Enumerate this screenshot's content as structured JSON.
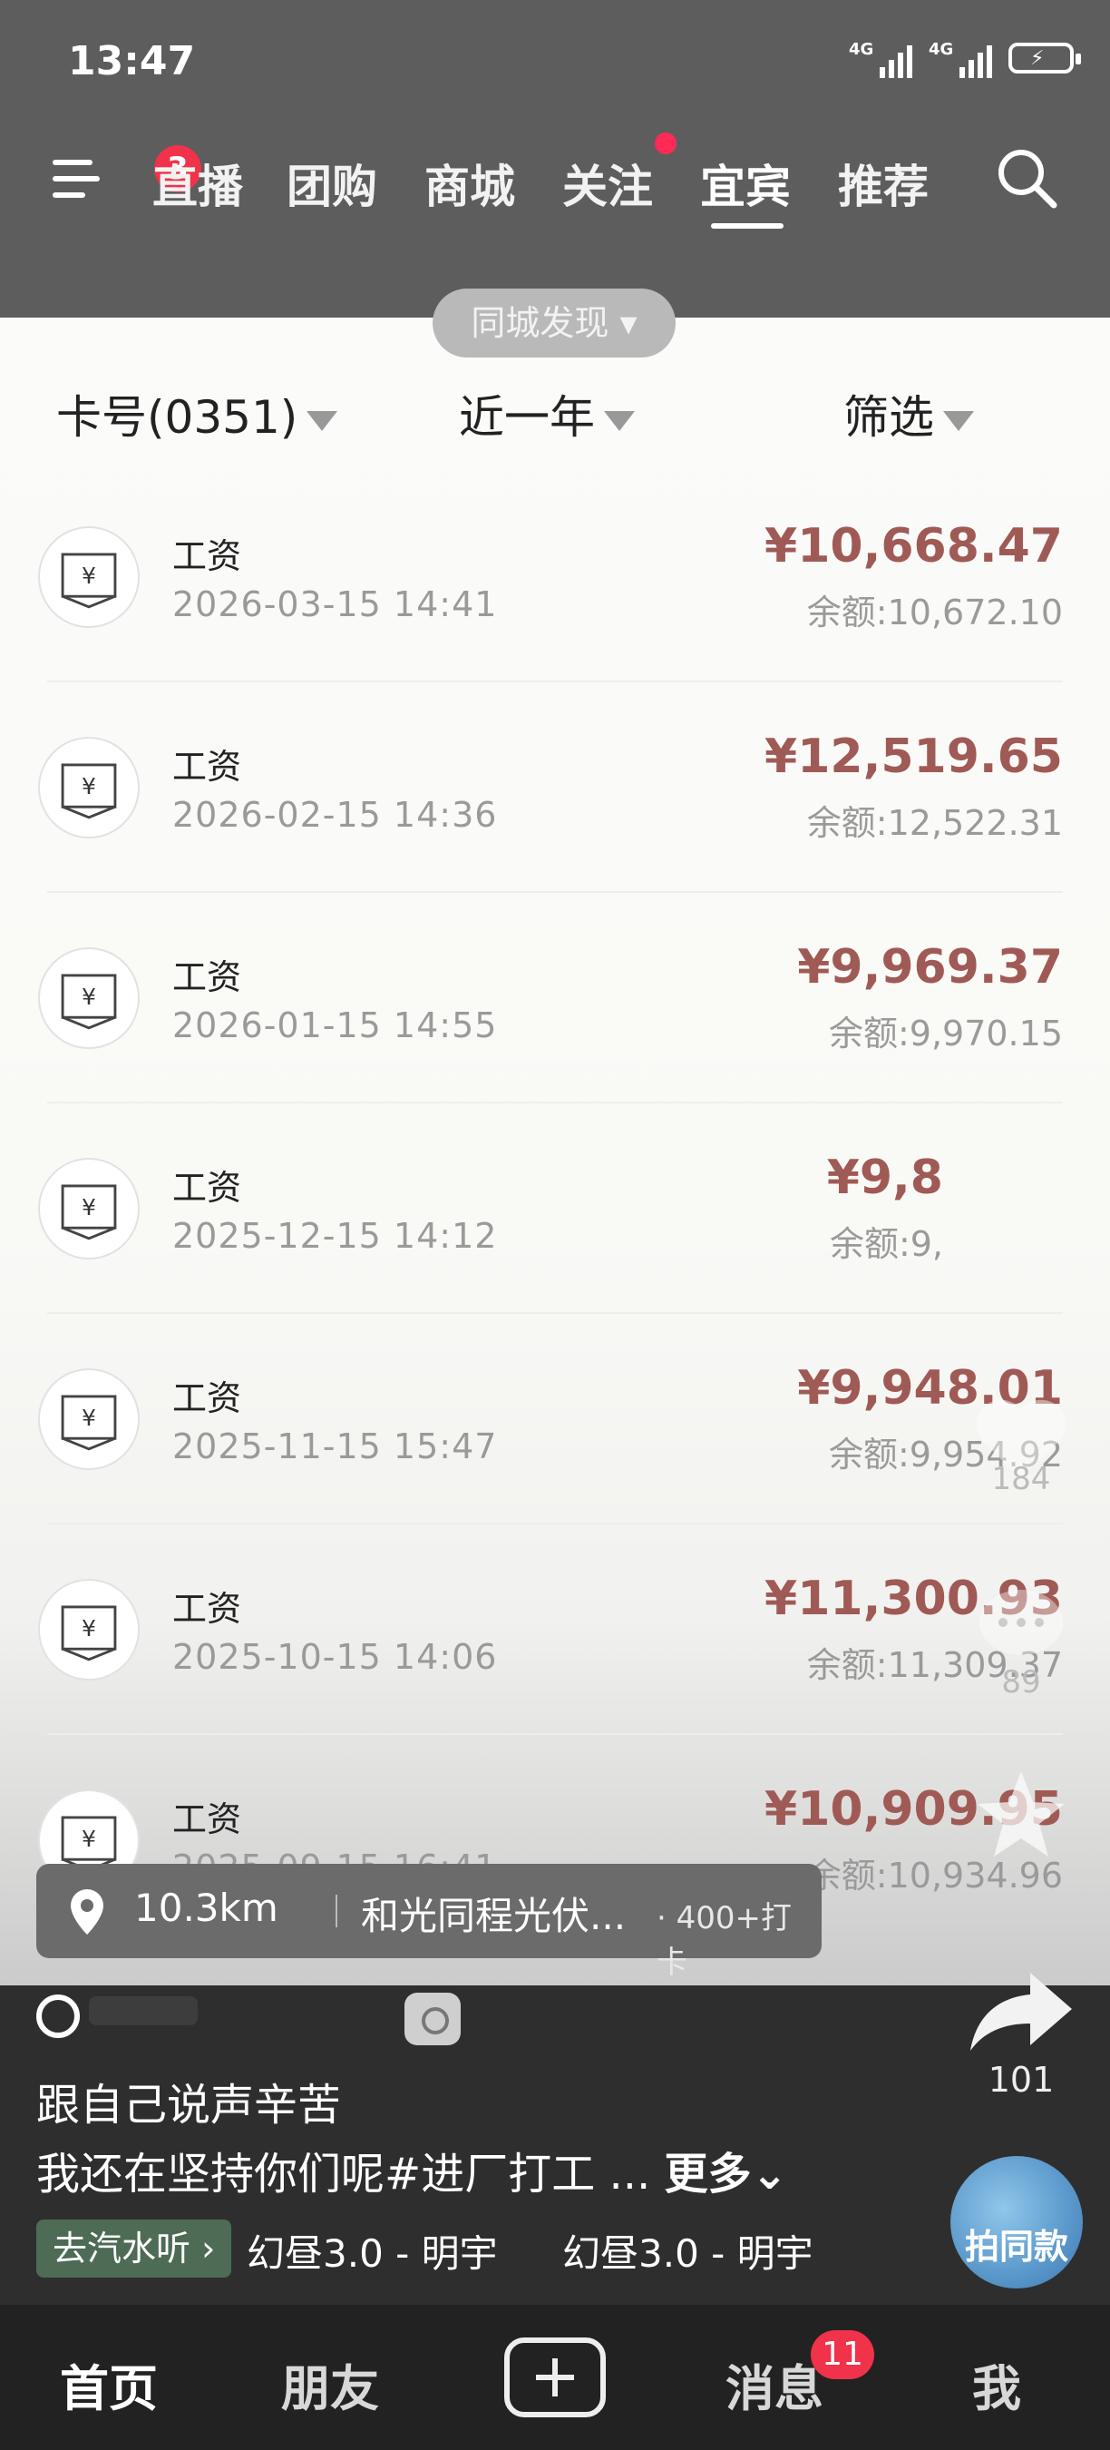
{
  "status_bar": {
    "time": "13:47",
    "signal1": "4G",
    "signal2": "4G"
  },
  "nav": {
    "menu_badge": "3",
    "tabs": [
      "直播",
      "团购",
      "商城",
      "关注",
      "宜宾",
      "推荐"
    ],
    "active_tab": "宜宾"
  },
  "city_pill": "同城发现",
  "filters": {
    "card": "卡号(0351)",
    "period": "近一年",
    "filter": "筛选"
  },
  "transactions": [
    {
      "title": "工资",
      "date": "2026-03-15 14:41",
      "amount": "¥10,668.47",
      "balance": "余额:10,672.10"
    },
    {
      "title": "工资",
      "date": "2026-02-15 14:36",
      "amount": "¥12,519.65",
      "balance": "余额:12,522.31"
    },
    {
      "title": "工资",
      "date": "2026-01-15 14:55",
      "amount": "¥9,969.37",
      "balance": "余额:9,970.15"
    },
    {
      "title": "工资",
      "date": "2025-12-15 14:12",
      "amount": "¥9,8",
      "balance": "余额:9,"
    },
    {
      "title": "工资",
      "date": "2025-11-15 15:47",
      "amount": "¥9,948.01",
      "balance": "余额:9,954.92"
    },
    {
      "title": "工资",
      "date": "2025-10-15 14:06",
      "amount": "¥11,300.93",
      "balance": "余额:11,309.37"
    },
    {
      "title": "工资",
      "date": "2025-09-15 16:41",
      "amount": "¥10,909.95",
      "balance": "余额:10,934.96"
    }
  ],
  "side_counts": {
    "like": "184",
    "comment": "89"
  },
  "location": {
    "distance": "10.3km",
    "place": "和光同程光伏...",
    "checkin": "· 400+打卡"
  },
  "video": {
    "caption_line1": "跟自己说声辛苦",
    "caption_line2": "我还在坚持你们呢#进厂打工 ...",
    "more": "更多",
    "tag": "去汽水听",
    "music1": "幻昼3.0 - 明宇",
    "music2": "幻昼3.0 - 明宇",
    "share_count": "101",
    "same_style": "拍同款"
  },
  "tabbar": {
    "home": "首页",
    "friends": "朋友",
    "messages": "消息",
    "messages_badge": "11",
    "me": "我"
  }
}
